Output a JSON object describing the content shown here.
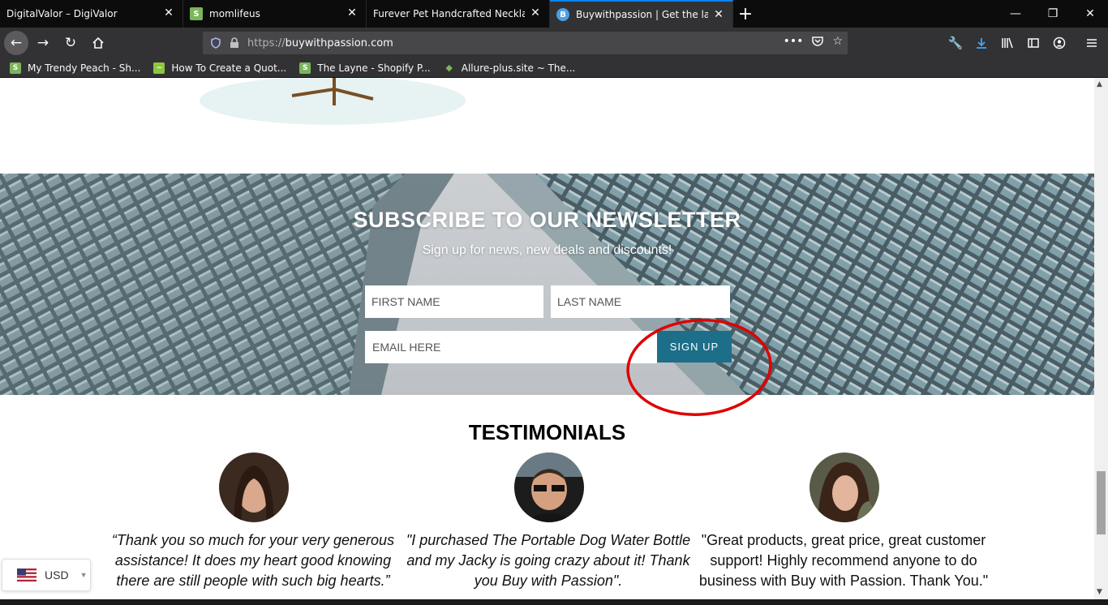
{
  "browser": {
    "tabs": [
      {
        "title": "DigitalValor – DigiValor",
        "favicon": "none"
      },
      {
        "title": "momlifeus",
        "favicon": "shopify-icon"
      },
      {
        "title": "Furever Pet Handcrafted Necklace -",
        "favicon": "none"
      },
      {
        "title": "Buywithpassion | Get the latest",
        "favicon": "b-icon",
        "active": true
      }
    ],
    "url_protocol": "https://",
    "url_host": "buywithpassion.com",
    "bookmarks": [
      {
        "label": "My Trendy Peach - Sh...",
        "icon": "shopify-icon"
      },
      {
        "label": "How To Create a Quot...",
        "icon": "quote-icon"
      },
      {
        "label": "The Layne - Shopify P...",
        "icon": "shopify-icon"
      },
      {
        "label": "Allure-plus.site ~ The...",
        "icon": "shopify-icon"
      }
    ]
  },
  "newsletter": {
    "title": "SUBSCRIBE TO OUR NEWSLETTER",
    "subtitle": "Sign up for news, new deals and discounts!",
    "first_name_placeholder": "FIRST NAME",
    "last_name_placeholder": "LAST NAME",
    "email_placeholder": "EMAIL HERE",
    "signup_label": "SIGN UP"
  },
  "testimonials": {
    "title": "TESTIMONIALS",
    "items": [
      {
        "quote": "“Thank you so much for your very generous assistance! It does my heart good knowing there are still people with such big hearts.”",
        "style": "italic"
      },
      {
        "quote": "\"I purchased The Portable Dog Water Bottle and my Jacky is going crazy about it! Thank you Buy with Passion\".",
        "style": "italic"
      },
      {
        "quote": "\"Great products, great price, great customer support! Highly recommend anyone to do business with Buy with Passion. Thank You.\"",
        "style": "normal"
      }
    ]
  },
  "currency": {
    "code": "USD",
    "flag": "us-flag-icon"
  },
  "colors": {
    "signup_button": "#1d6e88",
    "annotation_circle": "#e00000",
    "active_tab_accent": "#0a84ff"
  }
}
